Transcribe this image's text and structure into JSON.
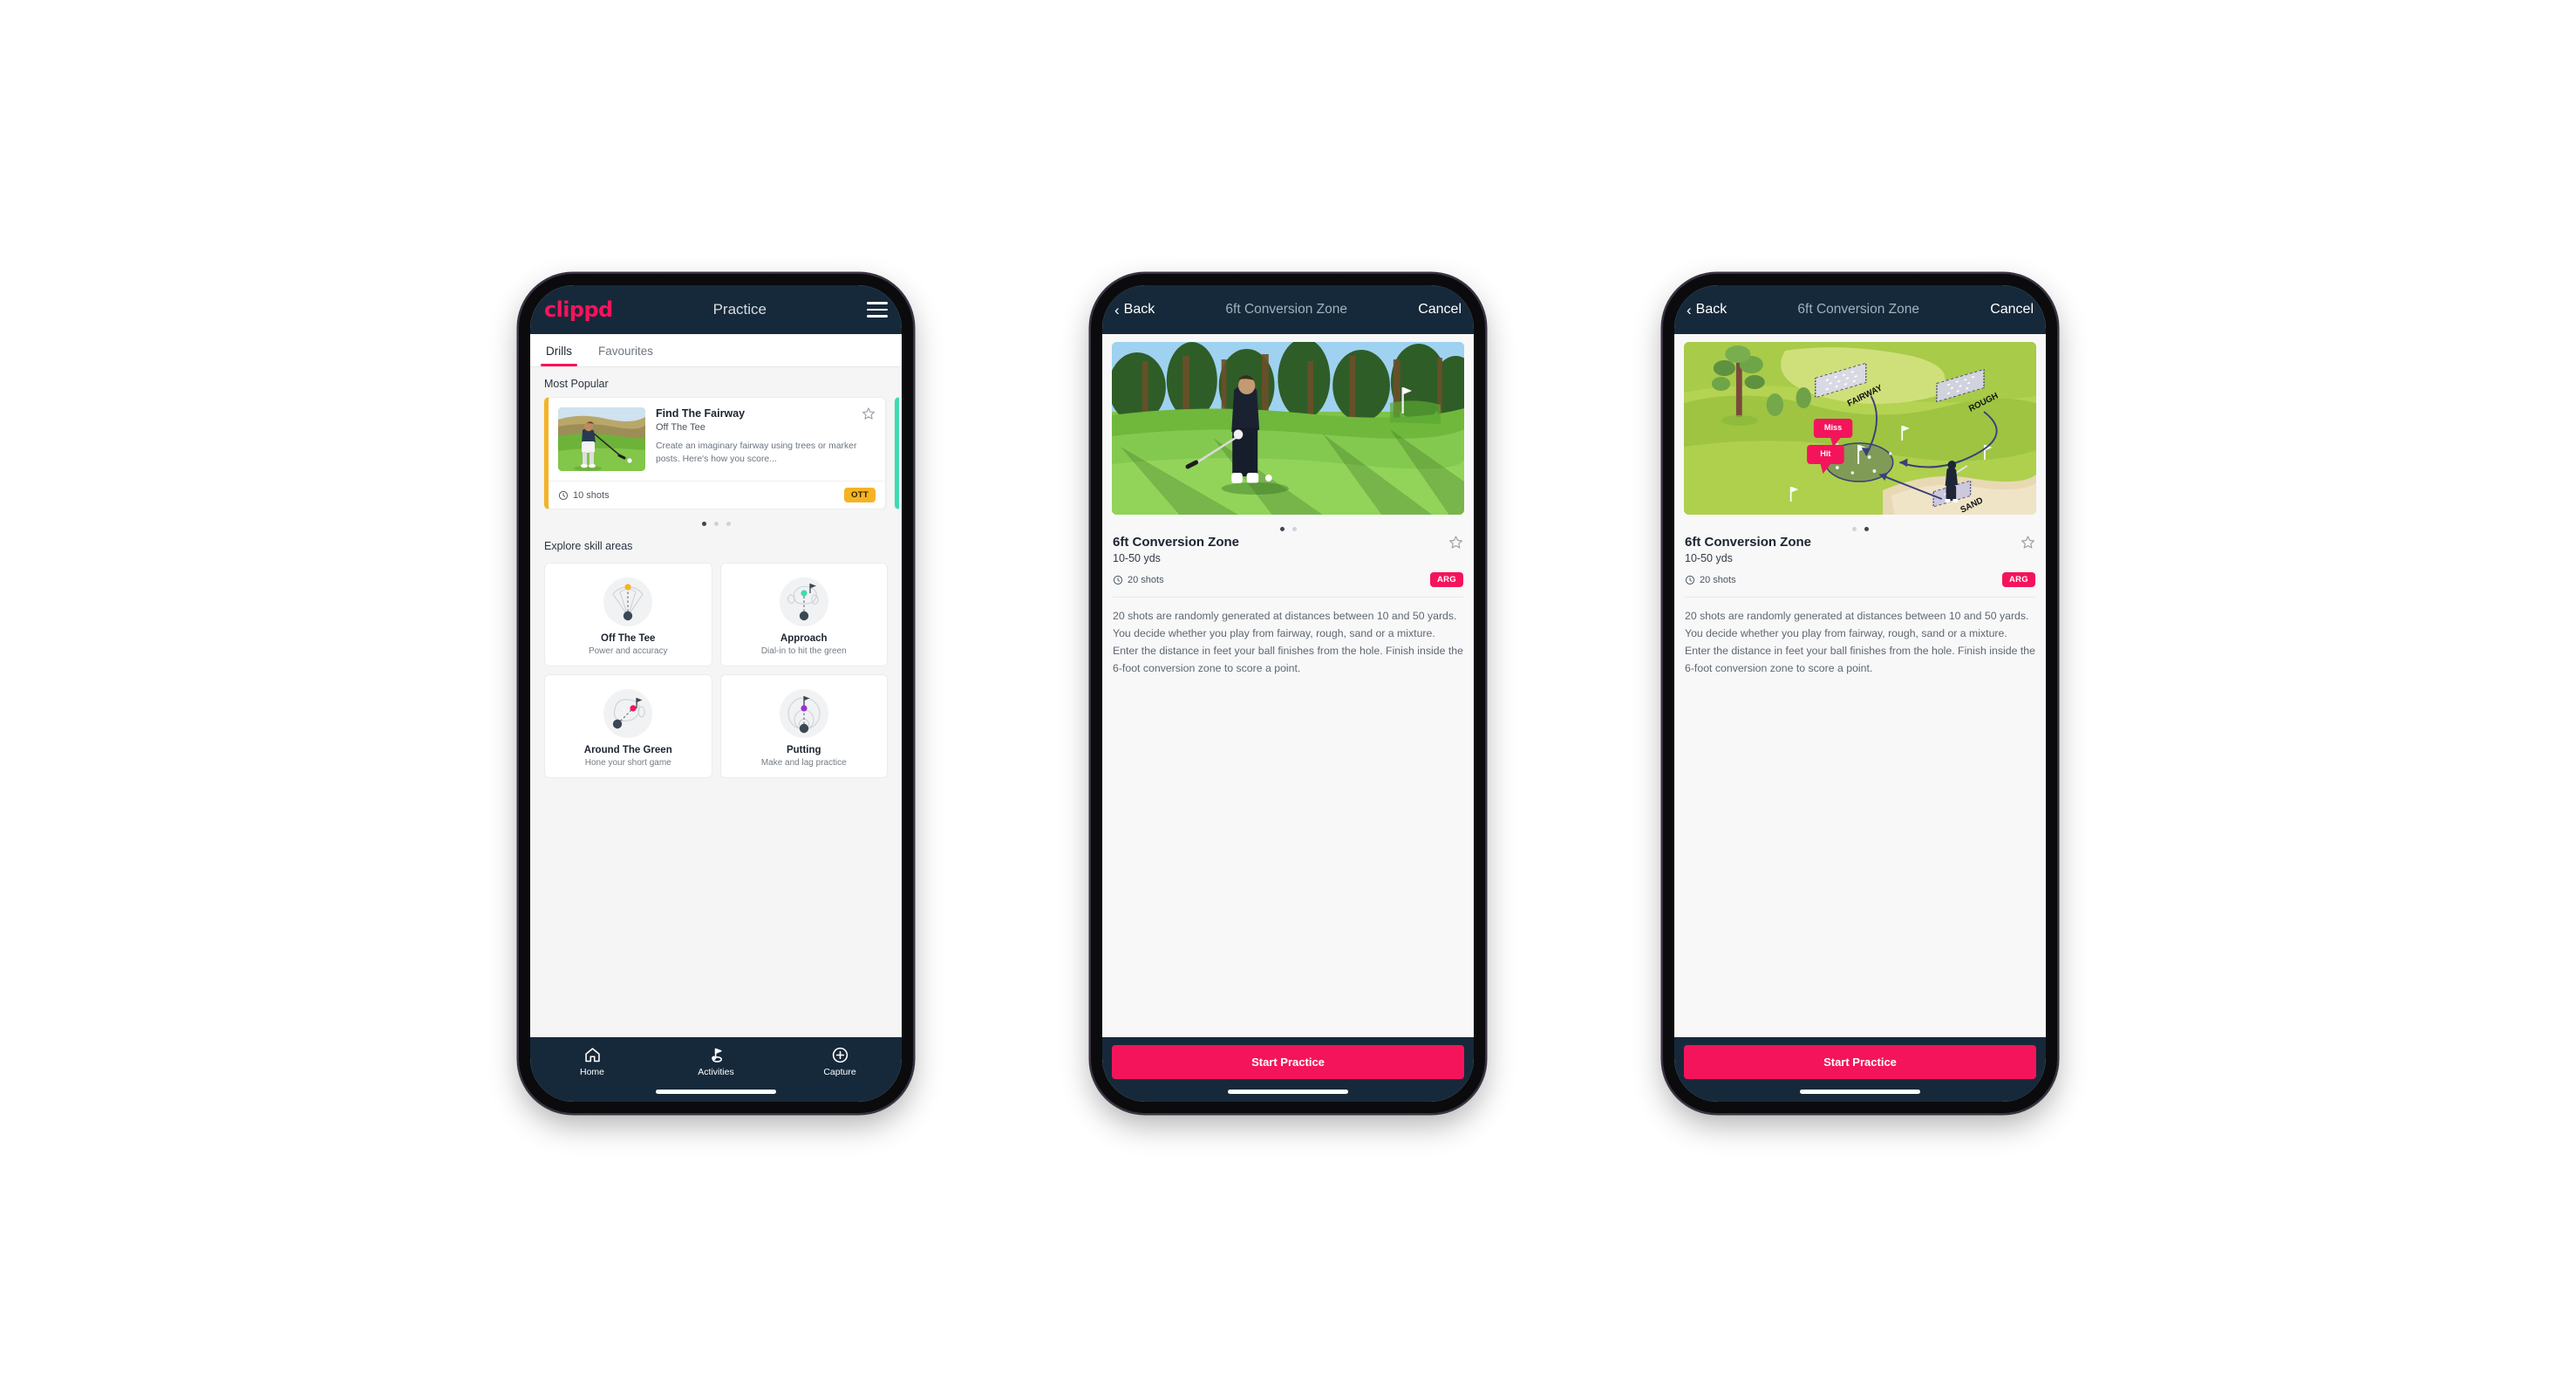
{
  "app": {
    "brand": "clippd",
    "accent_pink": "#f4145b",
    "dark_navy": "#16293a",
    "ott_yellow": "#f5b324",
    "arg_pink": "#f4145b",
    "teal": "#3ddbb0"
  },
  "phone1": {
    "header": {
      "brand": "clippd",
      "title": "Practice",
      "menu_icon": "hamburger-icon"
    },
    "tabs": [
      {
        "label": "Drills",
        "active": true
      },
      {
        "label": "Favourites",
        "active": false
      }
    ],
    "most_popular": {
      "section_label": "Most Popular",
      "card": {
        "title": "Find The Fairway",
        "subtitle": "Off The Tee",
        "description": "Create an imaginary fairway using trees or marker posts. Here's how you score...",
        "shots": "10 shots",
        "badge": "OTT",
        "accent": "#f5b324",
        "favourite_icon": "star-outline-icon",
        "shots_icon": "clock-icon",
        "thumbnail": "golfer-teeing-off-photo"
      },
      "pager": {
        "count": 3,
        "active_index": 0
      }
    },
    "explore": {
      "section_label": "Explore skill areas",
      "items": [
        {
          "name": "Off The Tee",
          "desc": "Power and accuracy",
          "icon": "tee-shot-fan-icon",
          "dot_color": "#f5b324"
        },
        {
          "name": "Approach",
          "desc": "Dial-in to hit the green",
          "icon": "approach-green-icon",
          "dot_color": "#3ddbb0"
        },
        {
          "name": "Around The Green",
          "desc": "Hone your short game",
          "icon": "chip-around-green-icon",
          "dot_color": "#f4145b"
        },
        {
          "name": "Putting",
          "desc": "Make and lag practice",
          "icon": "putting-rings-icon",
          "dot_color": "#9b30d9"
        }
      ]
    },
    "bottom_nav": [
      {
        "label": "Home",
        "icon": "home-icon",
        "active": false
      },
      {
        "label": "Activities",
        "icon": "golf-flag-icon",
        "active": true
      },
      {
        "label": "Capture",
        "icon": "plus-circle-icon",
        "active": false
      }
    ]
  },
  "phone2": {
    "header": {
      "back": "Back",
      "title": "6ft Conversion Zone",
      "cancel": "Cancel",
      "back_icon": "chevron-left-icon"
    },
    "media": {
      "type": "photo",
      "alt": "golfer-chipping-on-fairway-photo"
    },
    "pager": {
      "count": 2,
      "active_index": 0
    },
    "detail": {
      "title": "6ft Conversion Zone",
      "subtitle": "10-50 yds",
      "shots": "20 shots",
      "badge": "ARG",
      "shots_icon": "clock-icon",
      "favourite_icon": "star-outline-icon",
      "description": "20 shots are randomly generated at distances between 10 and 50 yards. You decide whether you play from fairway, rough, sand or a mixture. Enter the distance in feet your ball finishes from the hole. Finish inside the 6-foot conversion zone to score a point."
    },
    "cta": "Start Practice"
  },
  "phone3": {
    "header": {
      "back": "Back",
      "title": "6ft Conversion Zone",
      "cancel": "Cancel",
      "back_icon": "chevron-left-icon"
    },
    "media": {
      "type": "illustration",
      "alt": "golf-hole-diagram",
      "labels": {
        "fairway": "FAIRWAY",
        "rough": "ROUGH",
        "sand": "SAND",
        "miss": "Miss",
        "hit": "Hit"
      }
    },
    "pager": {
      "count": 2,
      "active_index": 1
    },
    "detail": {
      "title": "6ft Conversion Zone",
      "subtitle": "10-50 yds",
      "shots": "20 shots",
      "badge": "ARG",
      "shots_icon": "clock-icon",
      "favourite_icon": "star-outline-icon",
      "description": "20 shots are randomly generated at distances between 10 and 50 yards. You decide whether you play from fairway, rough, sand or a mixture. Enter the distance in feet your ball finishes from the hole. Finish inside the 6-foot conversion zone to score a point."
    },
    "cta": "Start Practice"
  }
}
